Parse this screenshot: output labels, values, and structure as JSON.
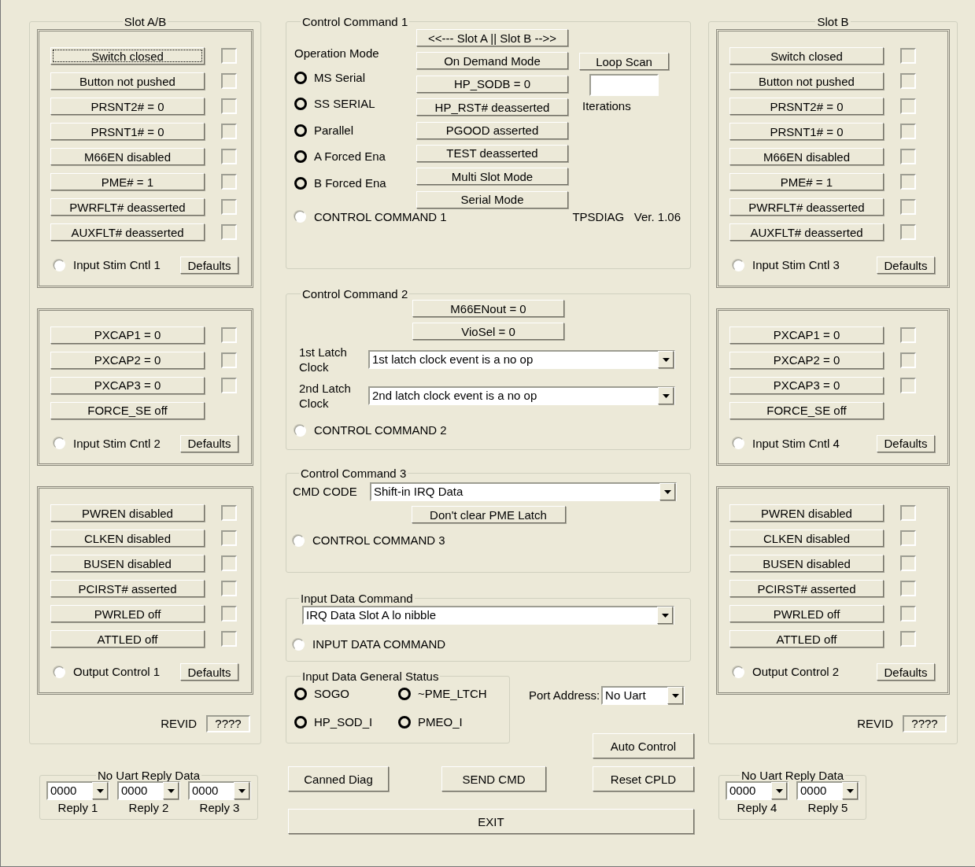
{
  "slot_panels": [
    {
      "title": "Slot A/B",
      "groups": [
        {
          "buttons": [
            {
              "label": "Switch closed",
              "kind": "check",
              "checked": false,
              "focused": true
            },
            {
              "label": "Button not pushed",
              "kind": "check",
              "checked": false,
              "focused": false
            },
            {
              "label": "PRSNT2# = 0",
              "kind": "check",
              "checked": false,
              "focused": false
            },
            {
              "label": "PRSNT1# = 0",
              "kind": "check",
              "checked": false,
              "focused": false
            },
            {
              "label": "M66EN disabled",
              "kind": "check",
              "checked": false,
              "focused": false
            },
            {
              "label": "PME# = 1",
              "kind": "check",
              "checked": false,
              "focused": false
            },
            {
              "label": "PWRFLT# deasserted",
              "kind": "check",
              "checked": false,
              "focused": false
            },
            {
              "label": "AUXFLT# deasserted",
              "kind": "check",
              "checked": false,
              "focused": false
            }
          ],
          "radio": {
            "label": "Input Stim Cntl 1",
            "selected": false
          },
          "defaults": "Defaults"
        },
        {
          "buttons": [
            {
              "label": "PXCAP1 = 0",
              "kind": "check",
              "checked": false,
              "focused": false
            },
            {
              "label": "PXCAP2 = 0",
              "kind": "check",
              "checked": false,
              "focused": false
            },
            {
              "label": "PXCAP3 = 0",
              "kind": "check",
              "checked": false,
              "focused": false
            },
            {
              "label": "FORCE_SE off",
              "kind": "plain",
              "focused": false
            }
          ],
          "radio": {
            "label": "Input Stim Cntl 2",
            "selected": false
          },
          "defaults": "Defaults"
        },
        {
          "buttons": [
            {
              "label": "PWREN disabled",
              "kind": "check",
              "checked": false,
              "focused": false
            },
            {
              "label": "CLKEN disabled",
              "kind": "check",
              "checked": false,
              "focused": false
            },
            {
              "label": "BUSEN disabled",
              "kind": "check",
              "checked": false,
              "focused": false
            },
            {
              "label": "PCIRST# asserted",
              "kind": "check",
              "checked": false,
              "focused": false
            },
            {
              "label": "PWRLED off",
              "kind": "check",
              "checked": false,
              "focused": false
            },
            {
              "label": "ATTLED off",
              "kind": "check",
              "checked": false,
              "focused": false
            }
          ],
          "radio": {
            "label": "Output Control 1",
            "selected": false
          },
          "defaults": "Defaults"
        }
      ],
      "revid": {
        "label": "REVID",
        "value": "????"
      },
      "reply_data": {
        "title": "No Uart Reply Data",
        "replies": [
          {
            "value": "0000",
            "label": "Reply 1"
          },
          {
            "value": "0000",
            "label": "Reply 2"
          },
          {
            "value": "0000",
            "label": "Reply 3"
          }
        ]
      }
    },
    {
      "title": "Slot B",
      "groups": [
        {
          "buttons": [
            {
              "label": "Switch closed",
              "kind": "check",
              "checked": false,
              "focused": false
            },
            {
              "label": "Button not pushed",
              "kind": "check",
              "checked": false,
              "focused": false
            },
            {
              "label": "PRSNT2# = 0",
              "kind": "check",
              "checked": false,
              "focused": false
            },
            {
              "label": "PRSNT1# = 0",
              "kind": "check",
              "checked": false,
              "focused": false
            },
            {
              "label": "M66EN disabled",
              "kind": "check",
              "checked": false,
              "focused": false
            },
            {
              "label": "PME# = 1",
              "kind": "check",
              "checked": false,
              "focused": false
            },
            {
              "label": "PWRFLT# deasserted",
              "kind": "check",
              "checked": false,
              "focused": false
            },
            {
              "label": "AUXFLT# deasserted",
              "kind": "check",
              "checked": false,
              "focused": false
            }
          ],
          "radio": {
            "label": "Input Stim Cntl 3",
            "selected": false
          },
          "defaults": "Defaults"
        },
        {
          "buttons": [
            {
              "label": "PXCAP1 = 0",
              "kind": "check",
              "checked": false,
              "focused": false
            },
            {
              "label": "PXCAP2 = 0",
              "kind": "check",
              "checked": false,
              "focused": false
            },
            {
              "label": "PXCAP3 = 0",
              "kind": "check",
              "checked": false,
              "focused": false
            },
            {
              "label": "FORCE_SE off",
              "kind": "plain",
              "focused": false
            }
          ],
          "radio": {
            "label": "Input Stim Cntl 4",
            "selected": false
          },
          "defaults": "Defaults"
        },
        {
          "buttons": [
            {
              "label": "PWREN disabled",
              "kind": "check",
              "checked": false,
              "focused": false
            },
            {
              "label": "CLKEN disabled",
              "kind": "check",
              "checked": false,
              "focused": false
            },
            {
              "label": "BUSEN disabled",
              "kind": "check",
              "checked": false,
              "focused": false
            },
            {
              "label": "PCIRST# asserted",
              "kind": "check",
              "checked": false,
              "focused": false
            },
            {
              "label": "PWRLED off",
              "kind": "check",
              "checked": false,
              "focused": false
            },
            {
              "label": "ATTLED off",
              "kind": "check",
              "checked": false,
              "focused": false
            }
          ],
          "radio": {
            "label": "Output Control 2",
            "selected": false
          },
          "defaults": "Defaults"
        }
      ],
      "revid": {
        "label": "REVID",
        "value": "????"
      },
      "reply_data": {
        "title": "No Uart Reply Data",
        "replies": [
          {
            "value": "0000",
            "label": "Reply 4"
          },
          {
            "value": "0000",
            "label": "Reply 5"
          }
        ]
      }
    }
  ],
  "control_command_1": {
    "title": "Control Command 1",
    "operation_mode": {
      "label": "Operation Mode",
      "leds": [
        {
          "label": "MS Serial",
          "on": false
        },
        {
          "label": "SS SERIAL",
          "on": false
        },
        {
          "label": "Parallel",
          "on": false
        },
        {
          "label": "A Forced Ena",
          "on": false
        },
        {
          "label": "B Forced Ena",
          "on": false
        }
      ]
    },
    "buttons": [
      "<<--- Slot A || Slot B -->>",
      "On Demand Mode",
      "HP_SODB = 0",
      "HP_RST# deasserted",
      "PGOOD asserted",
      "TEST deasserted",
      "Multi Slot Mode",
      "Serial Mode"
    ],
    "loop_scan": {
      "button": "Loop Scan",
      "label": "Iterations"
    },
    "radio": {
      "label": "CONTROL COMMAND 1",
      "selected": false
    },
    "version": "TPSDIAG   Ver. 1.06"
  },
  "control_command_2": {
    "title": "Control Command 2",
    "buttons": [
      "M66ENout = 0",
      "VioSel = 0"
    ],
    "selects": [
      {
        "label": "1st Latch Clock",
        "value": "1st latch clock event is a no op"
      },
      {
        "label": "2nd Latch Clock",
        "value": "2nd latch clock event is a no op"
      }
    ],
    "radio": {
      "label": "CONTROL COMMAND 2",
      "selected": false
    }
  },
  "control_command_3": {
    "title": "Control Command 3",
    "cmd_code": {
      "label": "CMD CODE",
      "value": "Shift-in IRQ Data"
    },
    "button": "Don't clear PME Latch",
    "radio": {
      "label": "CONTROL COMMAND 3",
      "selected": false
    }
  },
  "input_data_command": {
    "title": "Input Data Command",
    "value": "IRQ Data Slot A lo nibble",
    "radio": {
      "label": "INPUT DATA COMMAND",
      "selected": false
    }
  },
  "input_data_general_status": {
    "title": "Input Data General Status",
    "leds": [
      {
        "label": "SOGO",
        "on": false
      },
      {
        "label": "~PME_LTCH",
        "on": false
      },
      {
        "label": "HP_SOD_I",
        "on": false
      },
      {
        "label": "PMEO_I",
        "on": false
      }
    ]
  },
  "port_address": {
    "label": "Port Address:",
    "value": "No Uart"
  },
  "buttons": {
    "auto_control": "Auto Control",
    "canned_diag": "Canned Diag",
    "send_cmd": "SEND CMD",
    "reset_cpld": "Reset CPLD",
    "exit": "EXIT"
  }
}
